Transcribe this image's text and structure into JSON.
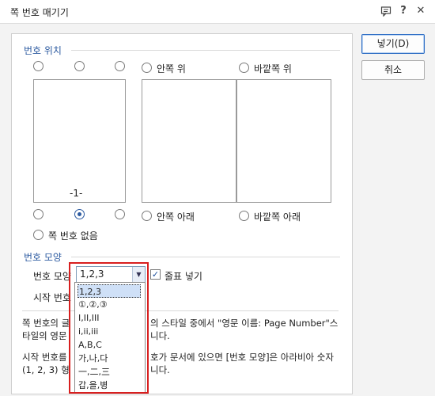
{
  "window": {
    "title": "쪽 번호 매기기"
  },
  "buttons": {
    "insert": "넣기(D)",
    "cancel": "취소"
  },
  "position_section": {
    "label": "번호 위치",
    "inner_top": "안쪽 위",
    "outer_top": "바깥쪽 위",
    "inner_bottom": "안쪽 아래",
    "outer_bottom": "바깥쪽 아래",
    "no_number": "쪽 번호 없음",
    "preview_number": "-1-"
  },
  "format_section": {
    "label": "번호 모양",
    "format_label": "번호 모양",
    "selected_format": "1,2,3",
    "dash_label": "줄표 넣기",
    "start_label": "시작 번호",
    "options": [
      "1,2,3",
      "①,②,③",
      "I,II,III",
      "i,ii,iii",
      "A,B,C",
      "가,나,다",
      "一,二,三",
      "갑,을,병"
    ]
  },
  "description": {
    "line1": "쪽 번호의 글",
    "line1b": "의 스타일 중에서 \"영문 이름: Page Number\"스",
    "line2": "타일의 영문",
    "line2b": "니다.",
    "line3": "시작 번호를",
    "line3b": "호가 문서에 있으면 [번호 모양]은 아라비아 숫자",
    "line4": "(1, 2, 3) 형",
    "line4b": "니다."
  }
}
